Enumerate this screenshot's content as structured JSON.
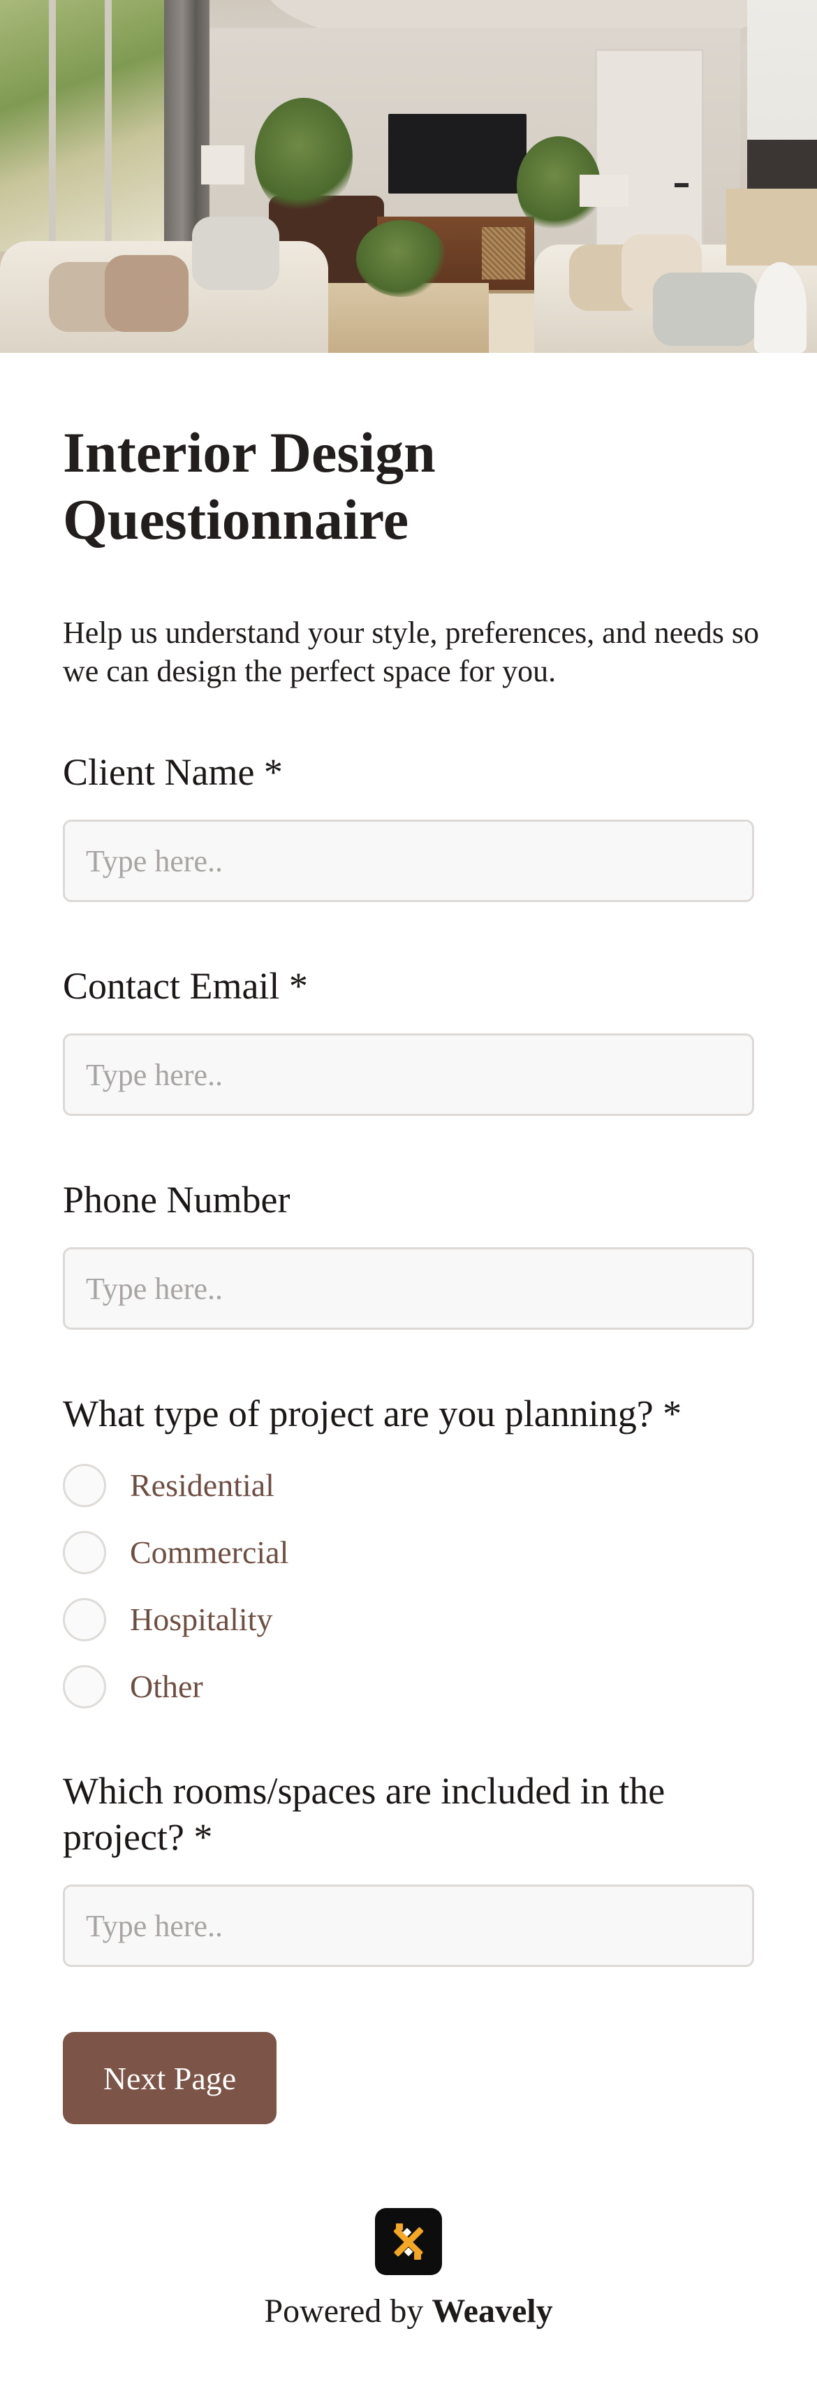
{
  "header": {
    "image_alt": "Living room interior"
  },
  "form": {
    "title": "Interior Design Questionnaire",
    "subtitle": "Help us understand your style, preferences, and needs so we can design the perfect space for you.",
    "fields": {
      "client_name": {
        "label": "Client Name *",
        "placeholder": "Type here..",
        "value": ""
      },
      "contact_email": {
        "label": "Contact Email *",
        "placeholder": "Type here..",
        "value": ""
      },
      "phone_number": {
        "label": "Phone Number",
        "placeholder": "Type here..",
        "value": ""
      },
      "rooms": {
        "label": "Which rooms/spaces are included in the project? *",
        "placeholder": "Type here..",
        "value": ""
      }
    },
    "project_type": {
      "label": "What type of project are you planning? *",
      "options": [
        "Residential",
        "Commercial",
        "Hospitality",
        "Other"
      ],
      "selected": null
    },
    "next_button": "Next Page"
  },
  "footer": {
    "powered_by": "Powered by",
    "brand": "Weavely",
    "logo_icon": "weavely-logo-icon"
  },
  "colors": {
    "accent": "#7c5548",
    "option_text": "#6f4e42",
    "input_bg": "#f8f8f8",
    "input_border": "#dcd9d6",
    "logo_bg": "#0d0d0d",
    "logo_mark": "#f5a623"
  }
}
